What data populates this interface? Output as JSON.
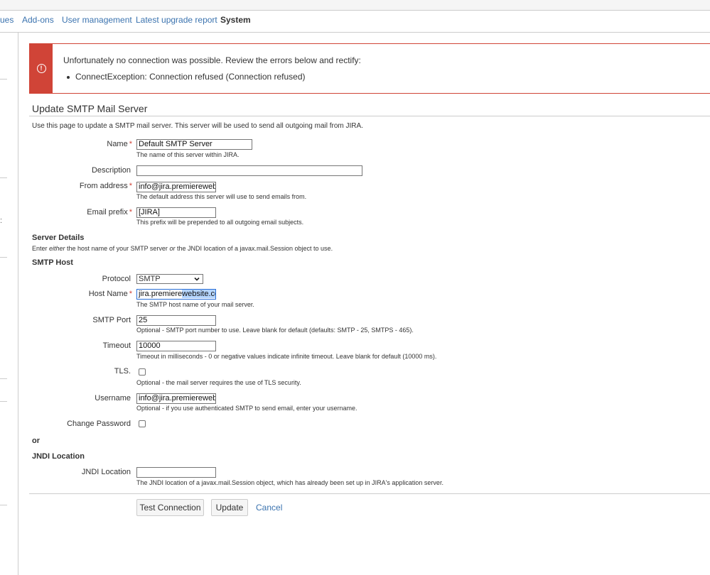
{
  "nav": {
    "tabs": [
      {
        "label": "ues"
      },
      {
        "label": "Add-ons"
      },
      {
        "label": "User management"
      },
      {
        "label": "Latest upgrade report"
      },
      {
        "label": "System"
      }
    ]
  },
  "sidebar": {
    "stray_char": ":"
  },
  "error": {
    "title": "Unfortunately no connection was possible. Review the errors below and rectify:",
    "items": [
      "ConnectException: Connection refused (Connection refused)"
    ],
    "icon": "error-circle-icon",
    "color": "#d04437"
  },
  "page": {
    "title": "Update SMTP Mail Server",
    "intro": "Use this page to update a SMTP mail server. This server will be used to send all outgoing mail from JIRA."
  },
  "form": {
    "required_mark": "*",
    "name": {
      "label": "Name",
      "value": "Default SMTP Server",
      "help": "The name of this server within JIRA."
    },
    "description": {
      "label": "Description",
      "value": ""
    },
    "from_address": {
      "label": "From address",
      "value": "info@jira.premierewebs",
      "help": "The default address this server will use to send emails from."
    },
    "email_prefix": {
      "label": "Email prefix",
      "value": "[JIRA]",
      "help": "This prefix will be prepended to all outgoing email subjects."
    },
    "server_details": {
      "heading": "Server Details",
      "note_a": "Enter ",
      "note_either": "either",
      "note_b": " the host name of your SMTP server ",
      "note_or": "or",
      "note_c": " the JNDI location of a javax.mail.Session object to use."
    },
    "smtp_host": {
      "heading": "SMTP Host"
    },
    "protocol": {
      "label": "Protocol",
      "value": "SMTP"
    },
    "host_name": {
      "label": "Host Name",
      "value_a": "jira.premiere",
      "value_b": "website.co",
      "help": "The SMTP host name of your mail server."
    },
    "smtp_port": {
      "label": "SMTP Port",
      "value": "25",
      "help": "Optional - SMTP port number to use. Leave blank for default (defaults: SMTP - 25, SMTPS - 465)."
    },
    "timeout": {
      "label": "Timeout",
      "value": "10000",
      "help": "Timeout in milliseconds - 0 or negative values indicate infinite timeout. Leave blank for default (10000 ms)."
    },
    "tls": {
      "label": "TLS.",
      "checked": false,
      "help": "Optional - the mail server requires the use of TLS security."
    },
    "username": {
      "label": "Username",
      "value": "info@jira.premierewebs",
      "help": "Optional - if you use authenticated SMTP to send email, enter your username."
    },
    "change_password": {
      "label": "Change Password",
      "checked": false
    },
    "or_label": "or",
    "jndi": {
      "heading": "JNDI Location",
      "label": "JNDI Location",
      "value": "",
      "help": "The JNDI location of a javax.mail.Session object, which has already been set up in JIRA's application server."
    }
  },
  "actions": {
    "test_connection": "Test Connection",
    "update": "Update",
    "cancel": "Cancel"
  }
}
